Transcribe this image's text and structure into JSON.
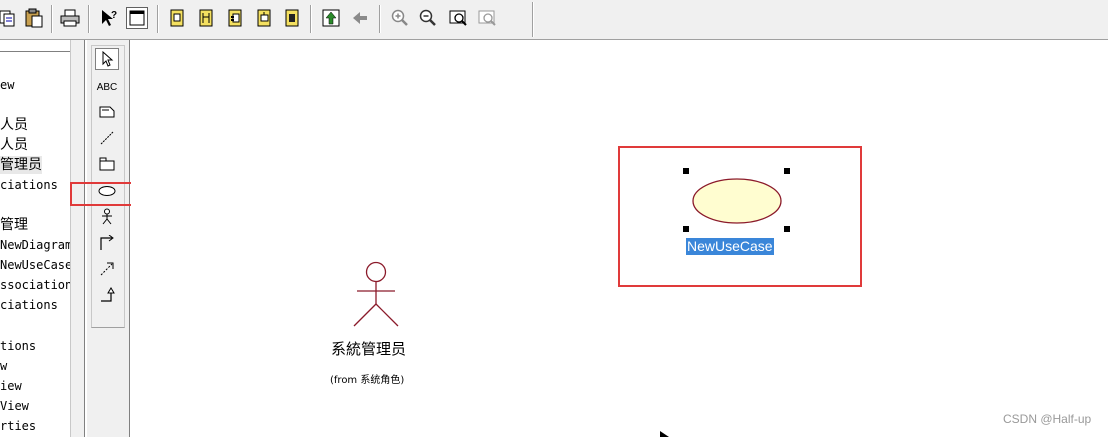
{
  "toolbar": {
    "buttons": [
      "copy-icon",
      "paste-icon",
      "print-icon",
      "context-help-icon",
      "view-doc-icon",
      "browse-class-diagram-icon",
      "browse-interaction-diagram-icon",
      "browse-component-diagram-icon",
      "browse-deployment-diagram-icon",
      "browse-parent-icon",
      "browse-previous-icon",
      "go-back-icon",
      "zoom-in-icon",
      "zoom-out-icon",
      "fit-window-icon",
      "undo-fit-icon"
    ]
  },
  "tree": {
    "items": [
      {
        "label": "ew",
        "cjk": false
      },
      {
        "label": "人员",
        "cjk": true
      },
      {
        "label": "人员",
        "cjk": true
      },
      {
        "label": "管理员",
        "cjk": true,
        "selected": true
      },
      {
        "label": "ciations",
        "cjk": false
      },
      {
        "label": "管理",
        "cjk": true
      },
      {
        "label": "NewDiagram",
        "cjk": false
      },
      {
        "label": "NewUseCase",
        "cjk": false
      },
      {
        "label": "ssociation",
        "cjk": false
      },
      {
        "label": "ciations",
        "cjk": false
      },
      {
        "label": "tions",
        "cjk": false
      },
      {
        "label": "w",
        "cjk": false
      },
      {
        "label": "iew",
        "cjk": false
      },
      {
        "label": "View",
        "cjk": false
      },
      {
        "label": "rties",
        "cjk": false
      }
    ]
  },
  "toolbox": {
    "tools": [
      "selection-arrow-icon",
      "text-box-tool",
      "note-tool",
      "anchor-note-tool",
      "package-tool",
      "use-case-tool",
      "actor-tool",
      "unidirectional-association-tool",
      "dependency-tool",
      "generalization-tool"
    ],
    "text_tool_label": "ABC"
  },
  "diagram": {
    "use_case": {
      "name": "NewUseCase",
      "fill": "#fffdd0",
      "stroke": "#8b1a2a",
      "selected": true
    },
    "actor": {
      "name": "系統管理员",
      "from": "(from 系统角色)",
      "stroke": "#8b1a2a"
    }
  },
  "watermark": "CSDN @Half-up",
  "colors": {
    "highlight_box": "#e03a3a",
    "label_selection": "#3a86d9"
  }
}
